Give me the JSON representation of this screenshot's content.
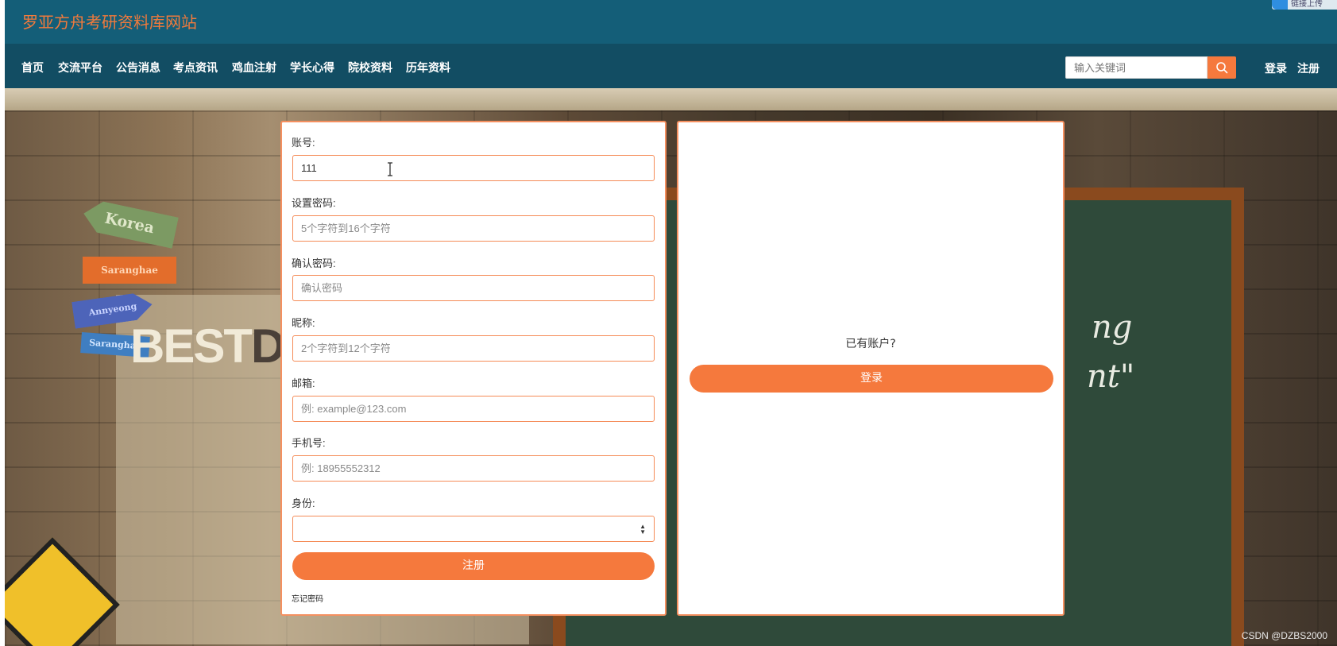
{
  "header": {
    "site_title": "罗亚方舟考研资料库网站",
    "corner_badge": "链接上传"
  },
  "nav": {
    "items": [
      "首页",
      "交流平台",
      "公告消息",
      "考点资讯",
      "鸡血注射",
      "学长心得",
      "院校资料",
      "历年资料"
    ],
    "search_placeholder": "输入关键词",
    "login_label": "登录",
    "register_label": "注册"
  },
  "register_form": {
    "account_label": "账号:",
    "account_value": "111",
    "password_label": "设置密码:",
    "password_placeholder": "5个字符到16个字符",
    "confirm_label": "确认密码:",
    "confirm_placeholder": "确认密码",
    "nickname_label": "昵称:",
    "nickname_placeholder": "2个字符到12个字符",
    "email_label": "邮箱:",
    "email_placeholder": "例: example@123.com",
    "phone_label": "手机号:",
    "phone_placeholder": "例: 18955552312",
    "identity_label": "身份:",
    "identity_value": "",
    "submit_label": "注册",
    "forgot_label": "忘记密码"
  },
  "login_panel": {
    "prompt": "已有账户?",
    "login_button": "登录"
  },
  "background": {
    "signs": [
      "Korea",
      "Saranghae",
      "Annyeong",
      "Saranghae"
    ],
    "banner_text": [
      "BEST",
      "DESIG"
    ],
    "chalk_text": [
      "ng",
      "nt\""
    ]
  },
  "watermark": "CSDN @DZBS2000",
  "colors": {
    "accent": "#f5793d",
    "header_bg": "#145e78",
    "nav_bg": "#124d63",
    "title_color": "#f07a3c"
  },
  "icons": {
    "search": "search-icon",
    "text_cursor": "text-cursor-icon",
    "select_arrows": "select-arrows-icon"
  }
}
